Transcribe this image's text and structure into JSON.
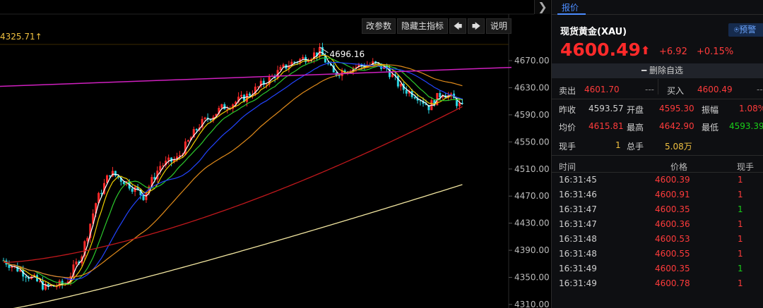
{
  "chart": {
    "toolbar": {
      "change_params": "改参数",
      "hide_indicator": "隐藏主指标",
      "left_arrow": "🡄",
      "right_arrow": "🡆",
      "help": "说明"
    },
    "prev_high_label": "4325.71",
    "peak_label": "4696.16",
    "collapse_label": "❯",
    "price_axis": [
      "4670.00",
      "4630.00",
      "4590.00",
      "4550.00",
      "4510.00",
      "4470.00",
      "4430.00",
      "4390.00",
      "4350.00",
      "4310.00"
    ],
    "colors": {
      "up": "#ff2a2a",
      "down": "#2ad3e0",
      "ma_white": "#ffffff",
      "ma_yellow": "#f0d000",
      "ma_green": "#2cc82c",
      "ma_blue": "#2244ff",
      "ma_orange": "#e08a1a",
      "ma_red": "#c0181c",
      "ma_cream": "#f2e6a0",
      "trendline": "#d020c0"
    }
  },
  "quote": {
    "tab_label": "报价",
    "name": "现货黄金(XAU)",
    "alert_label": "预警",
    "last_price": "4600.49",
    "change": "+6.92",
    "change_pct": "+0.15%",
    "remove_label": "删除自选",
    "bid_label": "卖出",
    "bid": "4601.70",
    "bid_vol": "---",
    "ask_label": "买入",
    "ask": "4600.49",
    "ask_vol": "---",
    "prev_close_label": "昨收",
    "prev_close": "4593.57",
    "open_label": "开盘",
    "open": "4595.30",
    "amplitude_label": "振幅",
    "amplitude": "1.08%",
    "avg_label": "均价",
    "avg": "4615.81",
    "high_label": "最高",
    "high": "4642.90",
    "low_label": "最低",
    "low": "4593.39",
    "cur_vol_label": "现手",
    "cur_vol": "1",
    "total_vol_label": "总手",
    "total_vol": "5.08万",
    "ticks_header": {
      "time": "时间",
      "price": "价格",
      "volume": "现手"
    },
    "ticks": [
      {
        "time": "16:31:45",
        "price": "4600.39",
        "vol": "1",
        "dir": "up"
      },
      {
        "time": "16:31:46",
        "price": "4600.91",
        "vol": "1",
        "dir": "up"
      },
      {
        "time": "16:31:47",
        "price": "4600.35",
        "vol": "1",
        "dir": "down"
      },
      {
        "time": "16:31:47",
        "price": "4600.36",
        "vol": "1",
        "dir": "up"
      },
      {
        "time": "16:31:48",
        "price": "4600.53",
        "vol": "1",
        "dir": "up"
      },
      {
        "time": "16:31:48",
        "price": "4600.55",
        "vol": "1",
        "dir": "up"
      },
      {
        "time": "16:31:49",
        "price": "4600.35",
        "vol": "1",
        "dir": "down"
      },
      {
        "time": "16:31:49",
        "price": "4600.78",
        "vol": "1",
        "dir": "up"
      }
    ]
  }
}
